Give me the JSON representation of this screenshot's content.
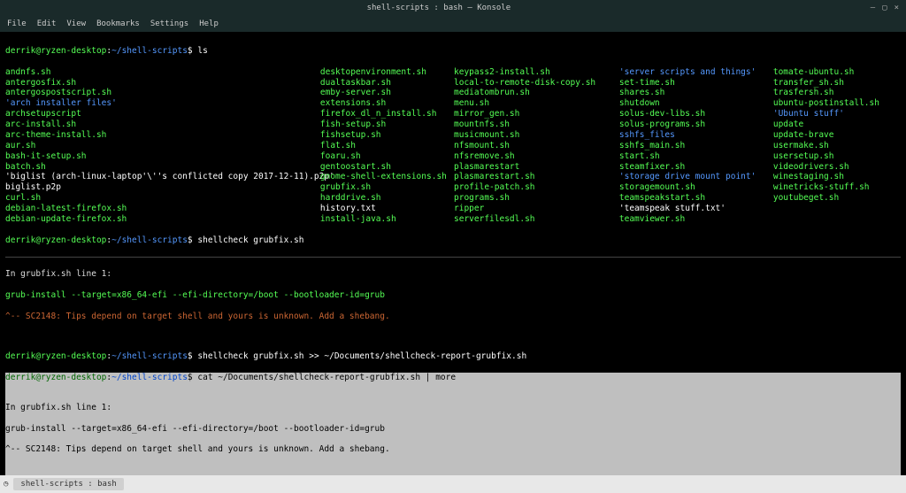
{
  "window": {
    "title": "shell-scripts : bash — Konsole",
    "controls": {
      "min": "—",
      "max": "▢",
      "close": "×"
    }
  },
  "menu": [
    "File",
    "Edit",
    "View",
    "Bookmarks",
    "Settings",
    "Help"
  ],
  "prompt": {
    "user": "derrik@ryzen-desktop",
    "path": "~/shell-scripts",
    "sep": ":",
    "end": "$"
  },
  "commands": {
    "ls": "ls",
    "shellcheck1": "shellcheck grubfix.sh",
    "shellcheck2": "shellcheck grubfix.sh >> ~/Documents/shellcheck-report-grubfix.sh",
    "cat": "cat ~/Documents/shellcheck-report-grubfix.sh | more"
  },
  "listing": {
    "col1": [
      {
        "t": "andnfs.sh",
        "c": "green"
      },
      {
        "t": "antergosfix.sh",
        "c": "green"
      },
      {
        "t": "antergospostscript.sh",
        "c": "green"
      },
      {
        "t": "'arch installer files'",
        "c": "blue"
      },
      {
        "t": "archsetupscript",
        "c": "green"
      },
      {
        "t": "arc-install.sh",
        "c": "green"
      },
      {
        "t": "arc-theme-install.sh",
        "c": "green"
      },
      {
        "t": "aur.sh",
        "c": "green"
      },
      {
        "t": "bash-it-setup.sh",
        "c": "green"
      },
      {
        "t": "batch.sh",
        "c": "green"
      },
      {
        "t": "'biglist (arch-linux-laptop'\\''s conflicted copy 2017-12-11).p2p'",
        "c": "white"
      },
      {
        "t": "biglist.p2p",
        "c": "white"
      },
      {
        "t": "curl.sh",
        "c": "green"
      },
      {
        "t": "debian-latest-firefox.sh",
        "c": "green"
      },
      {
        "t": "debian-update-firefox.sh",
        "c": "green"
      }
    ],
    "col2": [
      {
        "t": "desktopenvironment.sh",
        "c": "green"
      },
      {
        "t": "dualtaskbar.sh",
        "c": "green"
      },
      {
        "t": "emby-server.sh",
        "c": "green"
      },
      {
        "t": "extensions.sh",
        "c": "green"
      },
      {
        "t": "firefox_dl_n_install.sh",
        "c": "green"
      },
      {
        "t": "fish-setup.sh",
        "c": "green"
      },
      {
        "t": "fishsetup.sh",
        "c": "green"
      },
      {
        "t": "flat.sh",
        "c": "green"
      },
      {
        "t": "foaru.sh",
        "c": "green"
      },
      {
        "t": "gentoostart.sh",
        "c": "green"
      },
      {
        "t": "gnome-shell-extensions.sh",
        "c": "green"
      },
      {
        "t": "grubfix.sh",
        "c": "green"
      },
      {
        "t": "harddrive.sh",
        "c": "green"
      },
      {
        "t": "history.txt",
        "c": "white"
      },
      {
        "t": "install-java.sh",
        "c": "green"
      }
    ],
    "col3": [
      {
        "t": "keypass2-install.sh",
        "c": "green"
      },
      {
        "t": "local-to-remote-disk-copy.sh",
        "c": "green"
      },
      {
        "t": "mediatombrun.sh",
        "c": "green"
      },
      {
        "t": "menu.sh",
        "c": "green"
      },
      {
        "t": "mirror_gen.sh",
        "c": "green"
      },
      {
        "t": "mountnfs.sh",
        "c": "green"
      },
      {
        "t": "musicmount.sh",
        "c": "green"
      },
      {
        "t": "nfsmount.sh",
        "c": "green"
      },
      {
        "t": "nfsremove.sh",
        "c": "green"
      },
      {
        "t": "plasmarestart",
        "c": "green"
      },
      {
        "t": "plasmarestart.sh",
        "c": "green"
      },
      {
        "t": "profile-patch.sh",
        "c": "green"
      },
      {
        "t": "programs.sh",
        "c": "green"
      },
      {
        "t": "ripper",
        "c": "green"
      },
      {
        "t": "serverfilesdl.sh",
        "c": "green"
      }
    ],
    "col4": [
      {
        "t": "'server scripts and things'",
        "c": "blue"
      },
      {
        "t": "set-time.sh",
        "c": "green"
      },
      {
        "t": "shares.sh",
        "c": "green"
      },
      {
        "t": "shutdown",
        "c": "green"
      },
      {
        "t": "solus-dev-libs.sh",
        "c": "green"
      },
      {
        "t": "solus-programs.sh",
        "c": "green"
      },
      {
        "t": "sshfs_files",
        "c": "blue"
      },
      {
        "t": "sshfs_main.sh",
        "c": "green"
      },
      {
        "t": "start.sh",
        "c": "green"
      },
      {
        "t": "steamfixer.sh",
        "c": "green"
      },
      {
        "t": "'storage drive mount point'",
        "c": "blue"
      },
      {
        "t": "storagemount.sh",
        "c": "green"
      },
      {
        "t": "teamspeakstart.sh",
        "c": "green"
      },
      {
        "t": "'teamspeak stuff.txt'",
        "c": "white"
      },
      {
        "t": "teamviewer.sh",
        "c": "green"
      }
    ],
    "col5": [
      {
        "t": "tomate-ubuntu.sh",
        "c": "green"
      },
      {
        "t": "transfer_sh.sh",
        "c": "green"
      },
      {
        "t": "trasfersh.sh",
        "c": "green"
      },
      {
        "t": "ubuntu-postinstall.sh",
        "c": "green"
      },
      {
        "t": "'Ubuntu stuff'",
        "c": "blue"
      },
      {
        "t": "update",
        "c": "green"
      },
      {
        "t": "update-brave",
        "c": "green"
      },
      {
        "t": "usermake.sh",
        "c": "green"
      },
      {
        "t": "usersetup.sh",
        "c": "green"
      },
      {
        "t": "videodrivers.sh",
        "c": "green"
      },
      {
        "t": "winestaging.sh",
        "c": "green"
      },
      {
        "t": "winetricks-stuff.sh",
        "c": "green"
      },
      {
        "t": "youtubeget.sh",
        "c": "green"
      }
    ]
  },
  "shellcheck1": {
    "l1": "In grubfix.sh line 1:",
    "l2": "grub-install --target=x86_64-efi --efi-directory=/boot --bootloader-id=grub",
    "l3": "^-- SC2148: Tips depend on target shell and yours is unknown. Add a shebang."
  },
  "shellcheck2": {
    "l1": "In grubfix.sh line 1:",
    "l2": "grub-install --target=x86_64-efi --efi-directory=/boot --bootloader-id=grub",
    "l3": "^-- SC2148: Tips depend on target shell and yours is unknown. Add a shebang."
  },
  "taskbar": {
    "start_icon": "◷",
    "item": "shell-scripts : bash"
  }
}
